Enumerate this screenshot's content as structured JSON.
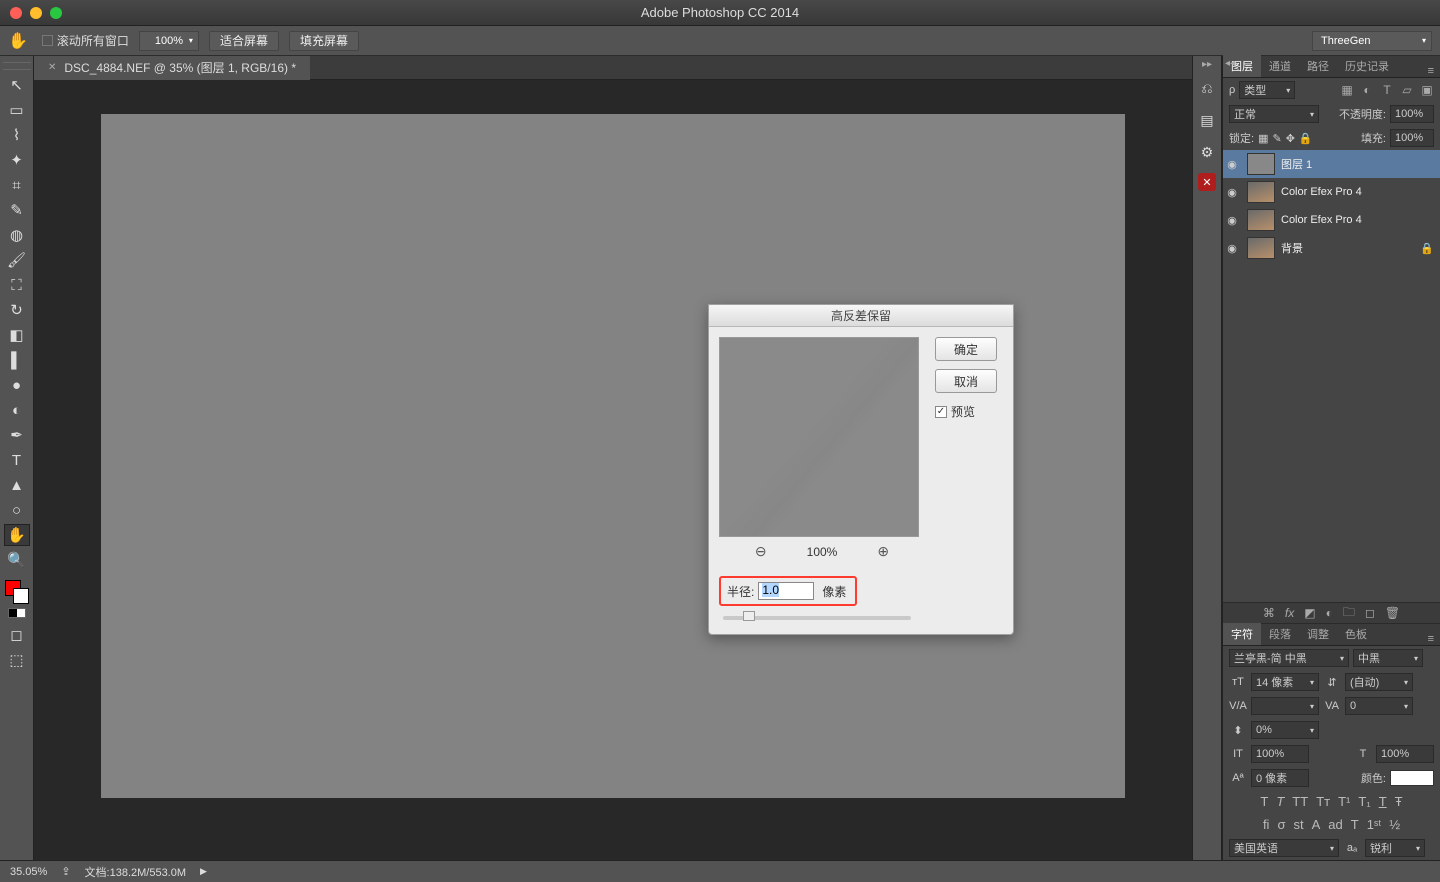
{
  "titlebar": {
    "title": "Adobe Photoshop CC 2014"
  },
  "optbar": {
    "scroll_all": "滚动所有窗口",
    "zoom": "100%",
    "fit": "适合屏幕",
    "fill": "填充屏幕",
    "workspace": "ThreeGen"
  },
  "doc": {
    "tab": "DSC_4884.NEF @ 35% (图层 1, RGB/16) *"
  },
  "layers_panel": {
    "tabs": [
      "图层",
      "通道",
      "路径",
      "历史记录"
    ],
    "filter_label": "类型",
    "blend_mode": "正常",
    "opacity_label": "不透明度:",
    "opacity_value": "100%",
    "lock_label": "锁定:",
    "fill_label": "填充:",
    "fill_value": "100%",
    "layers": [
      {
        "name": "图层 1",
        "selected": true,
        "thumb": "g"
      },
      {
        "name": "Color Efex Pro 4",
        "thumb": "i"
      },
      {
        "name": "Color Efex Pro 4",
        "thumb": "i"
      },
      {
        "name": "背景",
        "locked": true,
        "thumb": "i"
      }
    ]
  },
  "char_panel": {
    "tabs": [
      "字符",
      "段落",
      "调整",
      "色板"
    ],
    "font": "兰亭黑-简 中黑",
    "style": "中黑",
    "size": "14 像素",
    "leading": "(自动)",
    "va": "",
    "tracking": "0",
    "scale": "0%",
    "h": "100%",
    "v": "100%",
    "baseline": "0 像素",
    "color_label": "颜色:",
    "lang": "美国英语",
    "aa": "锐利"
  },
  "dialog": {
    "title": "高反差保留",
    "ok": "确定",
    "cancel": "取消",
    "preview": "预览",
    "zoom": "100%",
    "radius_label": "半径:",
    "radius_value": "1.0",
    "unit": "像素"
  },
  "status": {
    "zoom": "35.05%",
    "docinfo": "文档:138.2M/553.0M"
  }
}
